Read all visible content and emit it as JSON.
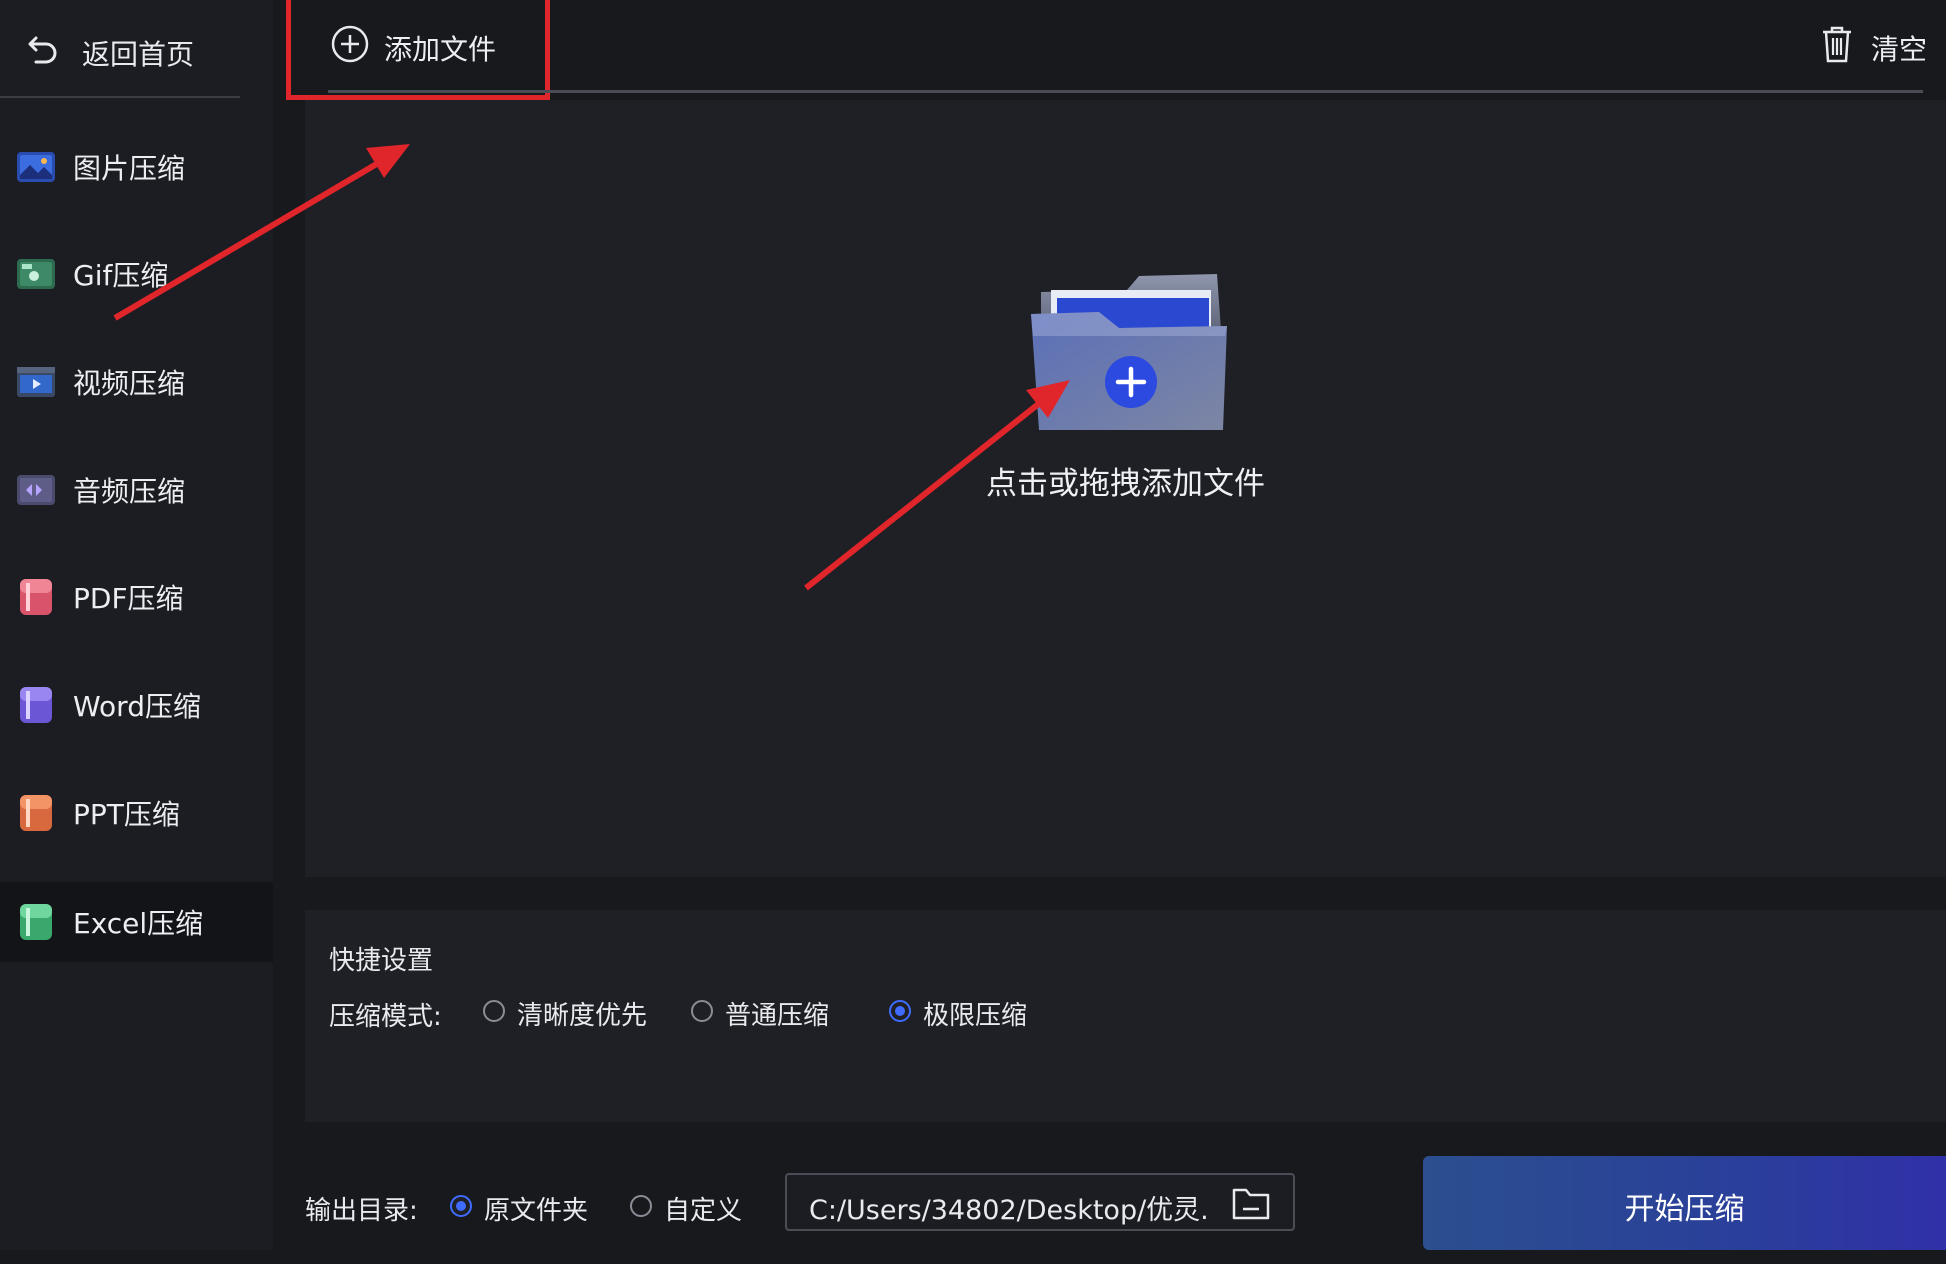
{
  "sidebar": {
    "back_label": "返回首页",
    "items": [
      {
        "label": "图片压缩",
        "icon": "image-compress-icon"
      },
      {
        "label": "Gif压缩",
        "icon": "gif-compress-icon"
      },
      {
        "label": "视频压缩",
        "icon": "video-compress-icon"
      },
      {
        "label": "音频压缩",
        "icon": "audio-compress-icon"
      },
      {
        "label": "PDF压缩",
        "icon": "pdf-compress-icon"
      },
      {
        "label": "Word压缩",
        "icon": "word-compress-icon"
      },
      {
        "label": "PPT压缩",
        "icon": "ppt-compress-icon"
      },
      {
        "label": "Excel压缩",
        "icon": "excel-compress-icon",
        "active": true
      }
    ]
  },
  "toolbar": {
    "add_file_label": "添加文件",
    "clear_label": "清空"
  },
  "drop_zone": {
    "hint": "点击或拖拽添加文件"
  },
  "quick_settings": {
    "title": "快捷设置",
    "mode_label": "压缩模式:",
    "modes": [
      {
        "label": "清晰度优先",
        "checked": false
      },
      {
        "label": "普通压缩",
        "checked": false
      },
      {
        "label": "极限压缩",
        "checked": true
      }
    ]
  },
  "output": {
    "label": "输出目录:",
    "options": [
      {
        "label": "原文件夹",
        "checked": true
      },
      {
        "label": "自定义",
        "checked": false
      }
    ],
    "path": "C:/Users/34802/Desktop/优灵."
  },
  "start_button_label": "开始压缩",
  "colors": {
    "accent": "#3f6cff",
    "annotation": "#e0252b",
    "start_button": "#2a3f9a"
  }
}
